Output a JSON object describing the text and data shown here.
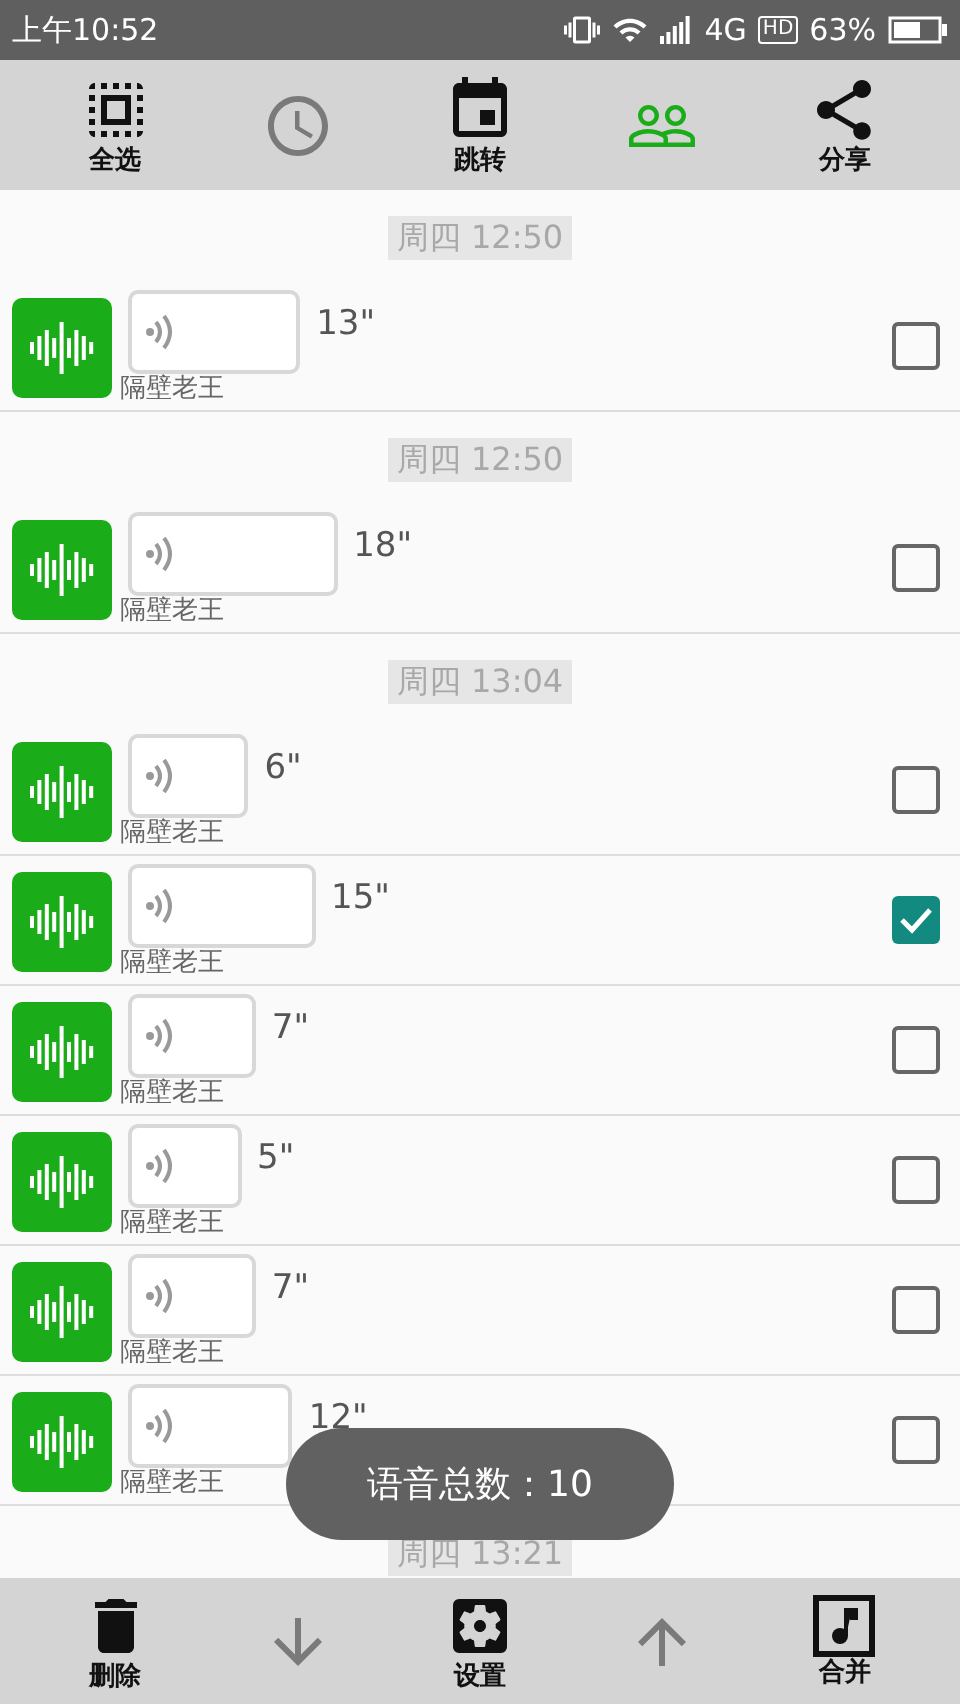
{
  "status_bar": {
    "time": "上午10:52",
    "network": "4G",
    "hd": "HD",
    "battery": "63%"
  },
  "toolbar": [
    {
      "kind": "select-all",
      "label": "全选",
      "disabled": false,
      "active": false
    },
    {
      "kind": "clock",
      "disabled": true,
      "active": false
    },
    {
      "kind": "calendar",
      "label": "跳转",
      "disabled": false,
      "active": false
    },
    {
      "kind": "people",
      "disabled": false,
      "active": true
    },
    {
      "kind": "share",
      "label": "分享",
      "disabled": false,
      "active": false
    }
  ],
  "messages": [
    {
      "date": "周四 12:50",
      "sender": "隔壁老王",
      "duration": "13\"",
      "checked": false
    },
    {
      "date": "周四 12:50",
      "sender": "隔壁老王",
      "duration": "18\"",
      "checked": false
    },
    {
      "date": "周四 13:04",
      "sender": "隔壁老王",
      "duration": "6\"",
      "checked": false
    },
    {
      "sender": "隔壁老王",
      "duration": "15\"",
      "checked": true
    },
    {
      "sender": "隔壁老王",
      "duration": "7\"",
      "checked": false
    },
    {
      "sender": "隔壁老王",
      "duration": "5\"",
      "checked": false
    },
    {
      "sender": "隔壁老王",
      "duration": "7\"",
      "checked": false
    },
    {
      "sender": "隔壁老王",
      "duration": "12\"",
      "checked": false
    },
    {
      "date": "周四 13:21"
    }
  ],
  "toast": "语音总数：10",
  "bottom_bar": [
    {
      "kind": "delete",
      "label": "删除",
      "disabled": false
    },
    {
      "kind": "down",
      "disabled": true
    },
    {
      "kind": "settings",
      "label": "设置",
      "disabled": false
    },
    {
      "kind": "up",
      "disabled": true
    },
    {
      "kind": "merge",
      "label": "合并",
      "disabled": false
    }
  ]
}
